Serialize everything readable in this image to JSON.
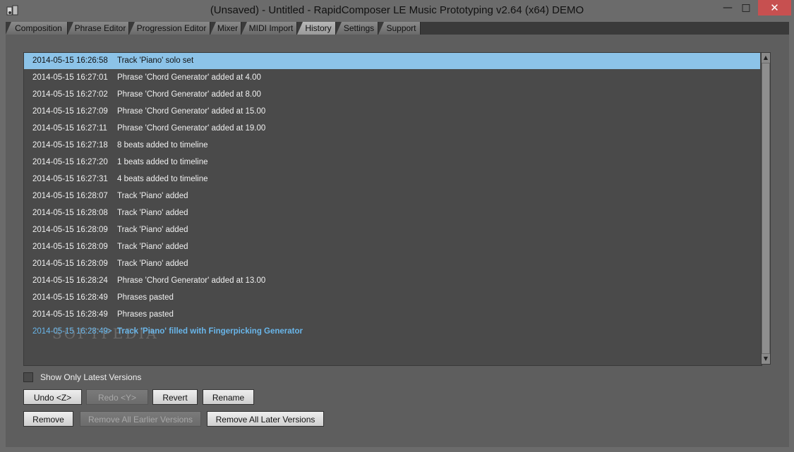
{
  "window": {
    "title": "(Unsaved) - Untitled - RapidComposer LE Music Prototyping v2.64 (x64) DEMO",
    "minimize_glyph": "—",
    "maximize_glyph": "□",
    "close_glyph": "✕"
  },
  "tabs": [
    {
      "label": "Composition",
      "active": false
    },
    {
      "label": "Phrase Editor",
      "active": false
    },
    {
      "label": "Progression Editor",
      "active": false
    },
    {
      "label": "Mixer",
      "active": false
    },
    {
      "label": "MIDI Import",
      "active": false
    },
    {
      "label": "History",
      "active": true
    },
    {
      "label": "Settings",
      "active": false
    },
    {
      "label": "Support",
      "active": false
    }
  ],
  "history": {
    "items": [
      {
        "timestamp": "2014-05-15 16:26:58",
        "description": "Track 'Piano' solo set"
      },
      {
        "timestamp": "2014-05-15 16:27:01",
        "description": "Phrase 'Chord Generator' added at 4.00"
      },
      {
        "timestamp": "2014-05-15 16:27:02",
        "description": "Phrase 'Chord Generator' added at 8.00"
      },
      {
        "timestamp": "2014-05-15 16:27:09",
        "description": "Phrase 'Chord Generator' added at 15.00"
      },
      {
        "timestamp": "2014-05-15 16:27:11",
        "description": "Phrase 'Chord Generator' added at 19.00"
      },
      {
        "timestamp": "2014-05-15 16:27:18",
        "description": "8 beats added to timeline"
      },
      {
        "timestamp": "2014-05-15 16:27:20",
        "description": "1 beats added to timeline"
      },
      {
        "timestamp": "2014-05-15 16:27:31",
        "description": "4 beats added to timeline"
      },
      {
        "timestamp": "2014-05-15 16:28:07",
        "description": "Track 'Piano' added"
      },
      {
        "timestamp": "2014-05-15 16:28:08",
        "description": "Track 'Piano' added"
      },
      {
        "timestamp": "2014-05-15 16:28:09",
        "description": "Track 'Piano' added"
      },
      {
        "timestamp": "2014-05-15 16:28:09",
        "description": "Track 'Piano' added"
      },
      {
        "timestamp": "2014-05-15 16:28:09",
        "description": "Track 'Piano' added"
      },
      {
        "timestamp": "2014-05-15 16:28:24",
        "description": "Phrase 'Chord Generator' added at 13.00"
      },
      {
        "timestamp": "2014-05-15 16:28:49",
        "description": "Phrases pasted"
      },
      {
        "timestamp": "2014-05-15 16:28:49",
        "description": "Phrases pasted"
      },
      {
        "timestamp": "2014-05-15 16:28:49",
        "description": "Track 'Piano' filled with Fingerpicking Generator"
      }
    ],
    "current_marker": "->",
    "selected_index": 0,
    "current_index": 16,
    "watermark": "SOFTPEDIA",
    "scroll_up_glyph": "▲",
    "scroll_down_glyph": "▼"
  },
  "options": {
    "show_only_latest_label": "Show Only Latest Versions",
    "show_only_latest_checked": false
  },
  "buttons": {
    "undo": "Undo <Z>",
    "redo": "Redo <Y>",
    "revert": "Revert",
    "rename": "Rename",
    "remove": "Remove",
    "remove_earlier": "Remove All Earlier Versions",
    "remove_later": "Remove All Later Versions"
  },
  "colors": {
    "selection": "#8cc3e8",
    "current_version_text": "#69b6ea",
    "close_button": "#c75050"
  }
}
